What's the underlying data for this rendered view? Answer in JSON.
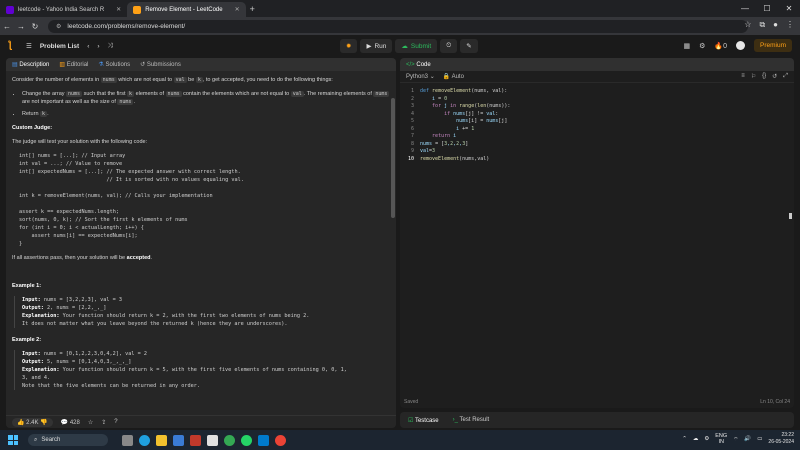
{
  "browser": {
    "tabs": [
      {
        "title": "leetcode - Yahoo India Search R",
        "favicon_color": "#6001d2"
      },
      {
        "title": "Remove Element - LeetCode",
        "favicon_color": "#ffa116"
      }
    ],
    "new_tab": "+",
    "window_controls": [
      "—",
      "☐",
      "✕"
    ],
    "url": "leetcode.com/problems/remove-element/"
  },
  "header": {
    "problem_list": "Problem List",
    "run": "Run",
    "submit": "Submit",
    "streak": "0",
    "premium": "Premium"
  },
  "left": {
    "tabs": [
      "Description",
      "Editorial",
      "Solutions",
      "Submissions"
    ],
    "intro": {
      "pre": "Consider the number of elements in",
      "c1": "nums",
      "mid": "which are not equal to",
      "c2": "val",
      "be": "be",
      "c3": "k",
      "post": ", to get accepted, you need to do the following things:"
    },
    "bullet1": {
      "a": "Change the array",
      "c1": "nums",
      "b": "such that the first",
      "c2": "k",
      "c": "elements of",
      "c3": "nums",
      "d": "contain the elements which are not equal to",
      "c4": "val",
      "e": ". The remaining elements of",
      "c5": "nums",
      "f": "are not important as well as the size of",
      "c6": "nums",
      "g": "."
    },
    "bullet2": {
      "a": "Return",
      "c1": "k",
      "b": "."
    },
    "custom_judge_title": "Custom Judge:",
    "judge_text": "The judge will test your solution with the following code:",
    "judge_code": "int[] nums = [...]; // Input array\nint val = ...; // Value to remove\nint[] expectedNums = [...]; // The expected answer with correct length.\n                            // It is sorted with no values equaling val.\n\nint k = removeElement(nums, val); // Calls your implementation\n\nassert k == expectedNums.length;\nsort(nums, 0, k); // Sort the first k elements of nums\nfor (int i = 0; i < actualLength; i++) {\n    assert nums[i] == expectedNums[i];\n}",
    "assertions": {
      "pre": "If all assertions pass, then your solution will be",
      "b": "accepted",
      "post": "."
    },
    "example1": {
      "title": "Example 1:",
      "input_label": "Input:",
      "input": " nums = [3,2,2,3], val = 3",
      "output_label": "Output:",
      "output": " 2, nums = [2,2,_,_]",
      "expl_label": "Explanation:",
      "expl": " Your function should return k = 2, with the first two elements of nums being 2.\nIt does not matter what you leave beyond the returned k (hence they are underscores)."
    },
    "example2": {
      "title": "Example 2:",
      "input_label": "Input:",
      "input": " nums = [0,1,2,2,3,0,4,2], val = 2",
      "output_label": "Output:",
      "output": " 5, nums = [0,1,4,0,3,_,_,_]",
      "expl_label": "Explanation:",
      "expl": " Your function should return k = 5, with the first five elements of nums containing 0, 0, 1,\n3, and 4.\nNote that the five elements can be returned in any order."
    },
    "footer": {
      "likes": "2.4K",
      "comments": "428"
    }
  },
  "right": {
    "title": "Code",
    "language": "Python3",
    "auto": "Auto",
    "code_lines": [
      {
        "n": "1",
        "t": "def removeElement(nums, val):"
      },
      {
        "n": "2",
        "t": "    i = 0"
      },
      {
        "n": "3",
        "t": "    for j in range(len(nums)):"
      },
      {
        "n": "4",
        "t": "        if nums[j] != val:"
      },
      {
        "n": "5",
        "t": "            nums[i] = nums[j]"
      },
      {
        "n": "6",
        "t": "            i += 1"
      },
      {
        "n": "7",
        "t": "    return i"
      },
      {
        "n": "8",
        "t": "nums = [3,2,2,3]"
      },
      {
        "n": "9",
        "t": "val=3"
      },
      {
        "n": "10",
        "t": "removeElement(nums,val)"
      }
    ],
    "saved": "Saved",
    "position": "Ln 10, Col 24",
    "test_tabs": [
      "Testcase",
      "Test Result"
    ]
  },
  "taskbar": {
    "search": "Search",
    "lang": "ENG",
    "lang2": "IN",
    "time": "23:22",
    "date": "26-05-2024"
  }
}
